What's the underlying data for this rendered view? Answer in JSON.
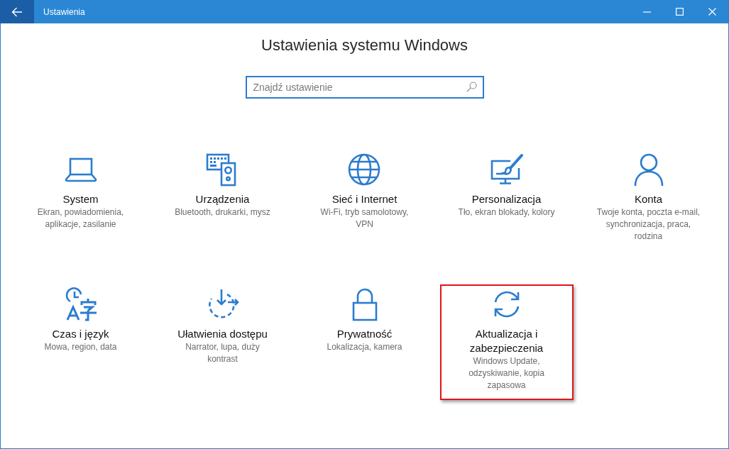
{
  "window": {
    "title": "Ustawienia"
  },
  "heading": "Ustawienia systemu Windows",
  "search": {
    "placeholder": "Znajdź ustawienie"
  },
  "categories": [
    {
      "title": "System",
      "description_lines": [
        "Ekran, powiadomienia,",
        "aplikacje, zasilanie"
      ],
      "highlighted": false
    },
    {
      "title": "Urządzenia",
      "description_lines": [
        "Bluetooth, drukarki, mysz"
      ],
      "highlighted": false
    },
    {
      "title": "Sieć i Internet",
      "description_lines": [
        "Wi-Fi, tryb samolotowy,",
        "VPN"
      ],
      "highlighted": false
    },
    {
      "title": "Personalizacja",
      "description_lines": [
        "Tło, ekran blokady, kolory"
      ],
      "highlighted": false
    },
    {
      "title": "Konta",
      "description_lines": [
        "Twoje konta, poczta e-mail,",
        "synchronizacja, praca,",
        "rodzina"
      ],
      "highlighted": false
    },
    {
      "title": "Czas i język",
      "description_lines": [
        "Mowa, region, data"
      ],
      "highlighted": false
    },
    {
      "title": "Ułatwienia dostępu",
      "description_lines": [
        "Narrator, lupa, duży",
        "kontrast"
      ],
      "highlighted": false
    },
    {
      "title": "Prywatność",
      "description_lines": [
        "Lokalizacja, kamera"
      ],
      "highlighted": false
    },
    {
      "title": "Aktualizacja i zabezpieczenia",
      "description_lines": [
        "Windows Update,",
        "odzyskiwanie, kopia",
        "zapasowa"
      ],
      "highlighted": true
    }
  ]
}
